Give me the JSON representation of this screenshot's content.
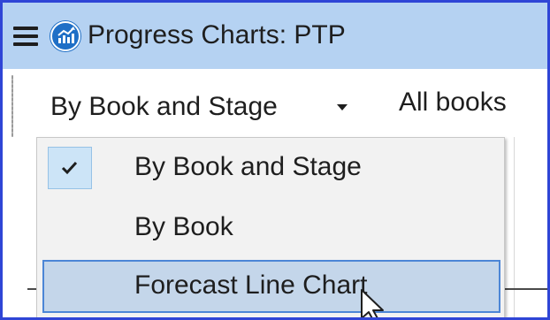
{
  "window": {
    "title": "Progress Charts: PTP",
    "menu_icon": "hamburger-menu-icon",
    "app_icon": "line-chart-app-icon",
    "frame_color": "#2f45d6",
    "titlebar_color": "#b5d2f2"
  },
  "toolbar": {
    "view_mode": {
      "selected": "By Book and Stage",
      "icon": "chevron-down-icon"
    },
    "book_filter": "All books"
  },
  "dropdown": {
    "items": [
      {
        "label": "By Book and Stage",
        "checked": true,
        "icon": "checkmark-icon"
      },
      {
        "label": "By Book",
        "checked": false
      },
      {
        "label": "Forecast Line Chart",
        "checked": false,
        "highlighted": true
      }
    ],
    "highlight_color": "#c4d6ea",
    "check_color": "#cce4f7"
  },
  "cursor": {
    "icon": "mouse-pointer-icon"
  }
}
